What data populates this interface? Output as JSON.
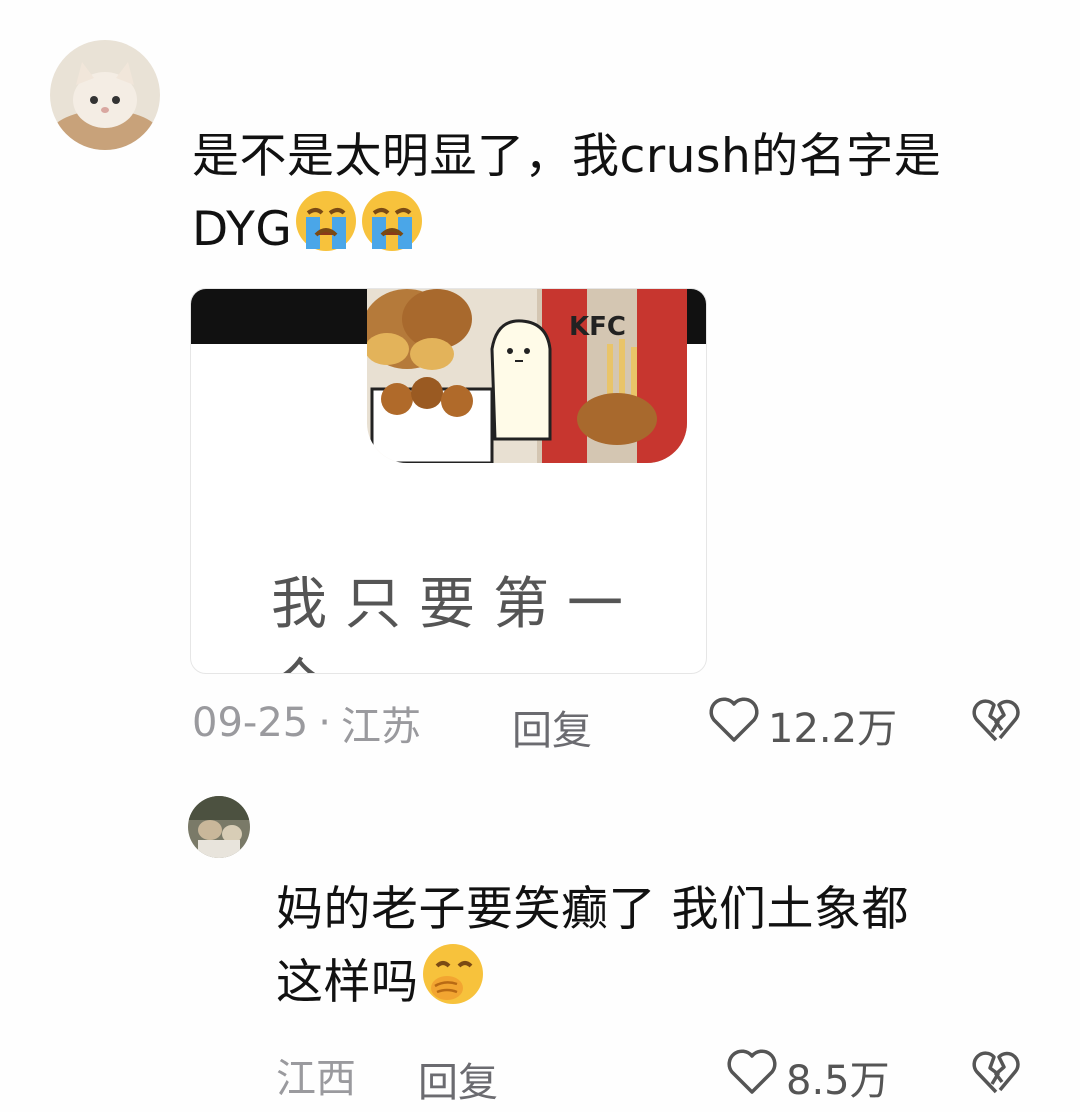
{
  "comments": [
    {
      "text_line1": "是不是太明显了，我crush的名字是",
      "text_line2": "DYG",
      "emoji_name": "loudly-crying-face",
      "sticker": {
        "caption": "我只要第一个",
        "logo_text": "KFC"
      },
      "date": "09-25",
      "separator": "·",
      "location": "江苏",
      "reply_label": "回复",
      "like_count": "12.2万"
    },
    {
      "text_line1": "妈的老子要笑癫了 我们土象都",
      "text_line2": "这样吗",
      "emoji_name": "face-with-hand-over-mouth",
      "location": "江西",
      "reply_label": "回复",
      "like_count": "8.5万"
    }
  ],
  "colors": {
    "meta_gray": "#9a9a9e",
    "text": "#111111"
  }
}
